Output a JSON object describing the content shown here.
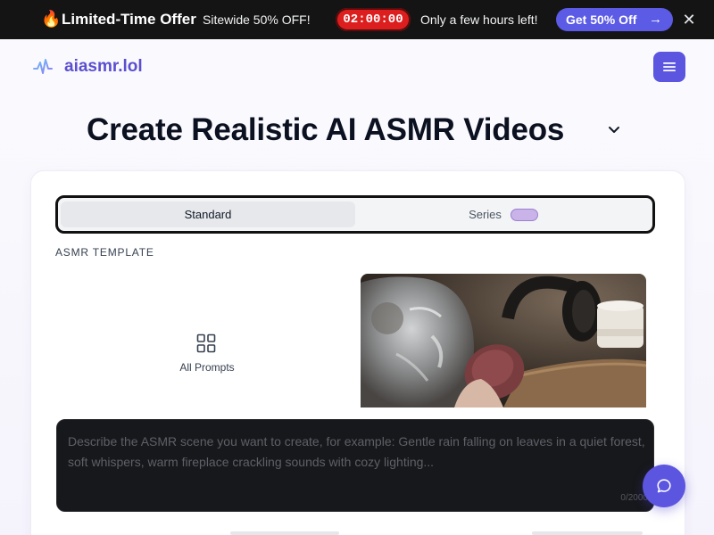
{
  "promo": {
    "emoji": "🔥",
    "headline": "Limited-Time Offer",
    "subtext": "Sitewide 50% OFF!",
    "countdown": "02:00:00",
    "urgency": "Only a few hours left!",
    "cta_label": "Get 50% Off",
    "cta_icon": "arrow-right-icon",
    "close_icon": "close-icon",
    "colors": {
      "bar": "#141414",
      "timer": "#dc1e1e",
      "cta": "#5b5be6"
    }
  },
  "header": {
    "brand": "aiasmr.lol",
    "logo_icon": "waveform-logo-icon",
    "menu_icon": "hamburger-menu-icon",
    "accent": "#5b55e0"
  },
  "hero": {
    "title": "Create Realistic AI ASMR Videos",
    "chevron_icon": "chevron-down-icon"
  },
  "generator": {
    "modes": [
      {
        "label": "Standard",
        "selected": true
      },
      {
        "label": "Series",
        "selected": false
      }
    ],
    "section_label": "ASMR TEMPLATE",
    "all_prompts_label": "All Prompts",
    "template_thumbnail": "glass-face-sponge-asmr-thumbnail",
    "prompt_placeholder": "Describe the ASMR scene you want to create, for example: Gentle rain falling on leaves in a quiet forest, soft whispers, warm fireplace crackling sounds with cozy lighting...",
    "char_count": "0/2000"
  },
  "chat": {
    "icon": "chat-bubble-icon"
  }
}
